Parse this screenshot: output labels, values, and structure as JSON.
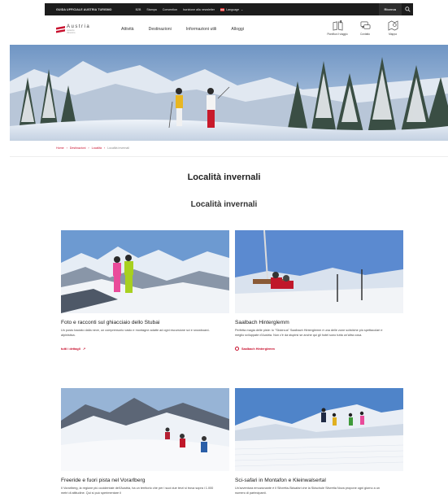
{
  "topbar": {
    "brand_link": "GUIDA UFFICIALE AUSTRIA TURISMO",
    "links": [
      "B2B",
      "Stampa",
      "Convention",
      "Iscrizione alla newsletter"
    ],
    "language": "Language",
    "search_label": "Ricerca"
  },
  "logo": {
    "name": "Austria",
    "tagline_1": "vacanze",
    "tagline_2": "d'inverno"
  },
  "menu": [
    "Attività",
    "Destinazioni",
    "Informazioni utili",
    "Alloggi"
  ],
  "tools": [
    {
      "label": "Pianifica il viaggio",
      "icon": "book-icon"
    },
    {
      "label": "Contatto",
      "icon": "chat-icon"
    },
    {
      "label": "Mappa",
      "icon": "map-icon"
    }
  ],
  "breadcrumb": {
    "home": "Home",
    "destinations": "Destinazioni",
    "places": "Località",
    "current": "Località invernali",
    "separator": "›"
  },
  "page_title": "Località invernali",
  "section_title": "Località invernali",
  "cards": [
    {
      "title": "Foto e racconti sul ghiacciaio dello Stubai",
      "text": "Un posto baciato dalla neve, un comprensorio vasto e montagne adatte ad ogni escursione sci e snowboard-alpinistica.",
      "link": "tutti i dettagli"
    },
    {
      "title": "Saalbach Hinterglemm",
      "text": "Perfetta magia delle piste: lo \"Skicircus\" Saalbach Hinterglemm è una delle zone sciistiche più spettacolari e meglio sviluppate d'Austria. Non c'è da stupirsi se anche qui gli hotel sono tutta un'altra cosa.",
      "link": "Saalbach Hinterglemm"
    },
    {
      "title": "Freeride e fuori pista nel Vorarlberg",
      "text": "Il Vorarlberg, la regione più occidentale dell'Austria, ha un territorio che per i suoi due terzi si trova sopra i 1.000 metri di altitudine. Qui si può sperimentare il",
      "link": ""
    },
    {
      "title": "Sci-safari in Montafon e Kleinwalsertal",
      "text": "Un'avventura emozionante è il Silvretta-Skisafari che la Skischule Silvretta Nova propone ogni giorno a un numero di partecipanti.",
      "link": ""
    }
  ],
  "colors": {
    "accent": "#c8102e",
    "topbar": "#1c1c1c"
  }
}
